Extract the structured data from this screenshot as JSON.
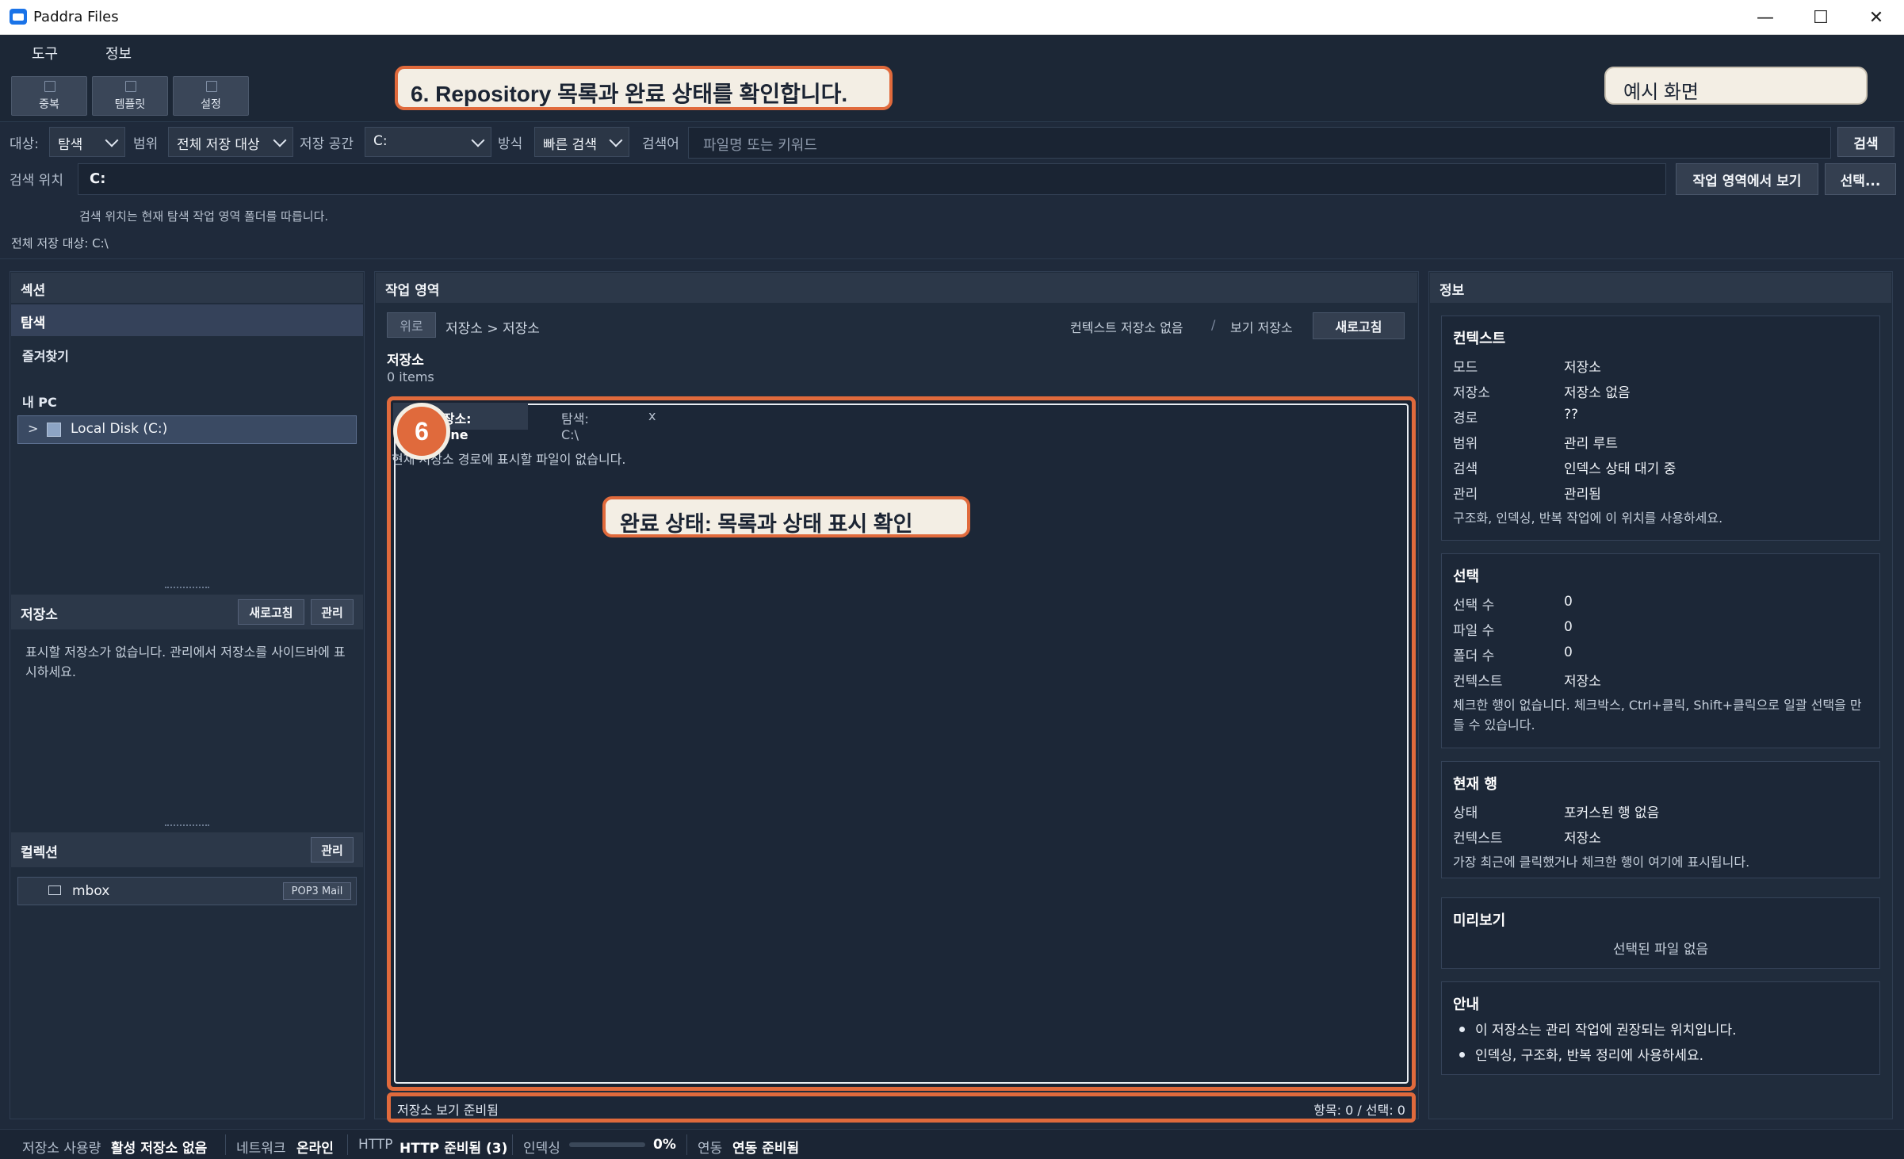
{
  "window": {
    "title": "Paddra Files",
    "controls": [
      "—",
      "☐",
      "✕"
    ]
  },
  "menu": [
    "도구",
    "정보"
  ],
  "toolbar": {
    "buttons": [
      "중복",
      "템플릿",
      "설정"
    ]
  },
  "callouts": {
    "step_title": "6. Repository 목록과 완료 상태를 확인합니다.",
    "example_tag": "예시 화면",
    "step_number": "6",
    "completion": "완료 상태: 목록과 상태 표시 확인"
  },
  "search": {
    "target_label": "대상:",
    "target_value": "탐색",
    "scope_label": "범위",
    "scope_value": "전체 저장 대상",
    "storage_label": "저장 공간",
    "storage_value": "C:",
    "method_label": "방식",
    "method_value": "빠른 검색",
    "keyword_label": "검색어",
    "keyword_placeholder": "파일명 또는 키워드",
    "search_button": "검색",
    "location_label": "검색 위치",
    "location_value": "C:",
    "view_in_workspace_button": "작업 영역에서 보기",
    "select_button": "선택...",
    "hint": "검색 위치는 현재 탐색 작업 영역 폴더를 따릅니다.",
    "all_targets": "전체 저장 대상: C:\\"
  },
  "sidebar": {
    "header": "섹션",
    "items": [
      "탐색",
      "즐겨찾기"
    ],
    "my_pc_label": "내 PC",
    "disk_label": "Local Disk (C:)",
    "disk_expander": ">",
    "repositories": {
      "header": "저장소",
      "refresh": "새로고침",
      "manage": "관리",
      "empty_message": "표시할 저장소가 없습니다. 관리에서 저장소를 사이드바에 표시하세요."
    },
    "collections": {
      "header": "컬렉션",
      "manage": "관리",
      "items": [
        {
          "name": "mbox",
          "badge": "POP3 Mail"
        }
      ]
    }
  },
  "workspace": {
    "header": "작업 영역",
    "up_button": "위로",
    "breadcrumb": "저장소 > 저장소",
    "context_none": "컨텍스트 저장소 없음",
    "divider": "/",
    "view_storage": "보기 저장소",
    "refresh": "새로고침",
    "folder_title": "저장소",
    "item_count": "0 items",
    "tabs": [
      {
        "label": "저장소: None"
      },
      {
        "label": "탐색: C:\\"
      }
    ],
    "tab_close": "x",
    "empty_message": "현재 저장소 경로에 표시할 파일이 없습니다.",
    "status_left": "저장소 보기 준비됨",
    "status_right": "항목: 0 / 선택: 0"
  },
  "info": {
    "header": "정보",
    "context": {
      "title": "컨텍스트",
      "rows": [
        [
          "모드",
          "저장소"
        ],
        [
          "저장소",
          "저장소 없음"
        ],
        [
          "경로",
          "??"
        ],
        [
          "범위",
          "관리 루트"
        ],
        [
          "검색",
          "인덱스 상태 대기 중"
        ],
        [
          "관리",
          "관리됨"
        ]
      ],
      "note": "구조화, 인덱싱, 반복 작업에 이 위치를 사용하세요."
    },
    "selection": {
      "title": "선택",
      "rows": [
        [
          "선택 수",
          "0"
        ],
        [
          "파일 수",
          "0"
        ],
        [
          "폴더 수",
          "0"
        ],
        [
          "컨텍스트",
          "저장소"
        ]
      ],
      "note": "체크한 행이 없습니다. 체크박스, Ctrl+클릭, Shift+클릭으로 일괄 선택을 만들 수 있습니다."
    },
    "current_row": {
      "title": "현재 행",
      "rows": [
        [
          "상태",
          "포커스된 행 없음"
        ],
        [
          "컨텍스트",
          "저장소"
        ]
      ],
      "note": "가장 최근에 클릭했거나 체크한 행이 여기에 표시됩니다."
    },
    "preview": {
      "title": "미리보기",
      "empty": "선택된 파일 없음"
    },
    "guide": {
      "title": "안내",
      "items": [
        "이 저장소는 관리 작업에 권장되는 위치입니다.",
        "인덱싱, 구조화, 반복 정리에 사용하세요."
      ]
    }
  },
  "statusbar": {
    "usage_label": "저장소 사용량",
    "usage_value": "활성 저장소 없음",
    "network_label": "네트워크",
    "network_value": "온라인",
    "http_label": "HTTP",
    "http_value": "HTTP 준비됨 (3)",
    "index_label": "인덱싱",
    "index_value": "0%",
    "index_progress": 0,
    "sync_label": "연동",
    "sync_value": "연동 준비됨"
  },
  "colors": {
    "accent": "#e06a3c",
    "background": "#1f2a3b",
    "panel": "#202c3c",
    "card": "#1c2737"
  }
}
